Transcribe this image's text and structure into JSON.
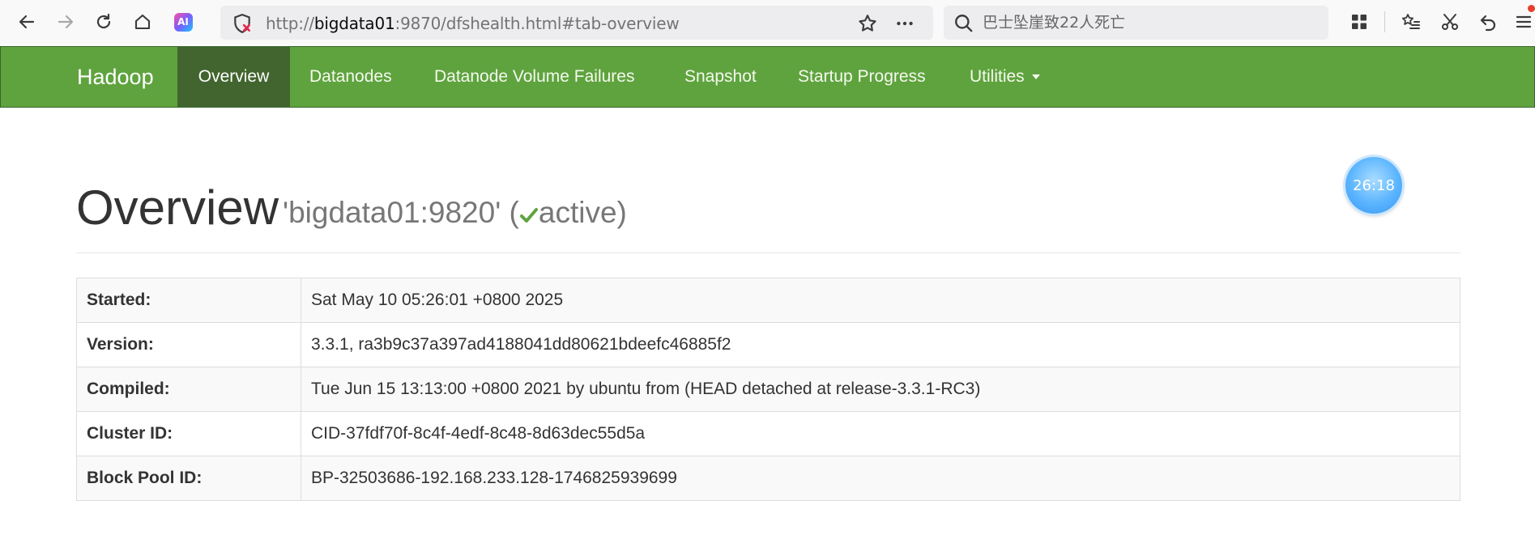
{
  "browser": {
    "url_prefix": "http://",
    "url_host": "bigdata01",
    "url_rest": ":9870/dfshealth.html#tab-overview",
    "search_placeholder": "巴士坠崖致22人死亡",
    "ai_badge": "AI"
  },
  "navbar": {
    "brand": "Hadoop",
    "items": [
      {
        "label": "Overview",
        "active": true
      },
      {
        "label": "Datanodes"
      },
      {
        "label": "Datanode Volume Failures"
      },
      {
        "label": "Snapshot"
      },
      {
        "label": "Startup Progress"
      },
      {
        "label": "Utilities"
      }
    ]
  },
  "header": {
    "title": "Overview",
    "host": "'bigdata01:9820'",
    "open_paren": "(",
    "state": "active",
    "close_paren": ")"
  },
  "timer": "26:18",
  "overview_table": [
    {
      "label": "Started:",
      "value": "Sat May 10 05:26:01 +0800 2025"
    },
    {
      "label": "Version:",
      "value": "3.3.1, ra3b9c37a397ad4188041dd80621bdeefc46885f2"
    },
    {
      "label": "Compiled:",
      "value": "Tue Jun 15 13:13:00 +0800 2021 by ubuntu from (HEAD detached at release-3.3.1-RC3)"
    },
    {
      "label": "Cluster ID:",
      "value": "CID-37fdf70f-8c4f-4edf-8c48-8d63dec55d5a"
    },
    {
      "label": "Block Pool ID:",
      "value": "BP-32503686-192.168.233.128-1746825939699"
    }
  ],
  "colors": {
    "navbar": "#5fa33e",
    "navbar_active": "#42652f",
    "check": "#5fa33e"
  }
}
